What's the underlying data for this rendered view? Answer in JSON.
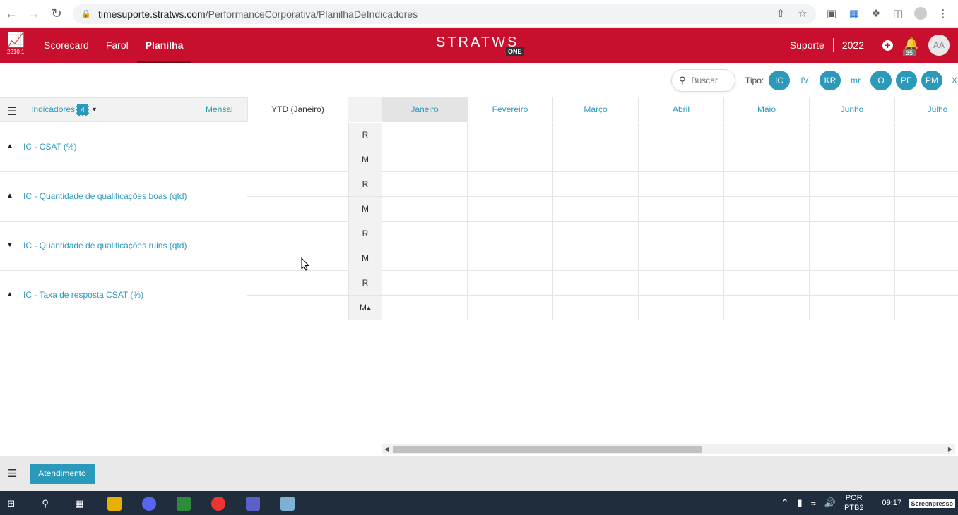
{
  "browser": {
    "url_host": "timesuporte.stratws.com",
    "url_path": "/PerformanceCorporativa/PlanilhaDeIndicadores"
  },
  "app": {
    "version": "2210.1",
    "nav": [
      "Scorecard",
      "Farol",
      "Planilha"
    ],
    "active_nav": "Planilha",
    "brand": "STRATWS",
    "brand_badge": "ONE",
    "context": "Suporte",
    "year": "2022",
    "notif_count": "35",
    "avatar": "AA"
  },
  "filters": {
    "search_placeholder": "Buscar",
    "tipo_label": "Tipo:",
    "chips": [
      {
        "label": "IC",
        "active": true
      },
      {
        "label": "IV",
        "active": false
      },
      {
        "label": "KR",
        "active": true
      },
      {
        "label": "mr",
        "active": false
      },
      {
        "label": "O",
        "active": true
      },
      {
        "label": "PE",
        "active": true
      },
      {
        "label": "PM",
        "active": true
      },
      {
        "label": "XY",
        "active": false
      }
    ]
  },
  "grid": {
    "indicators_label": "Indicadores",
    "indicators_count": "4",
    "period": "Mensal",
    "ytd": "YTD (Janeiro)",
    "months": [
      "Janeiro",
      "Fevereiro",
      "Março",
      "Abril",
      "Maio",
      "Junho",
      "Julho"
    ],
    "current_month": "Janeiro",
    "rows": [
      {
        "name": "IC - CSAT (%)",
        "direction": "up",
        "r": "R",
        "m": "M"
      },
      {
        "name": "IC - Quantidade de qualificações boas (qtd)",
        "direction": "up",
        "r": "R",
        "m": "M"
      },
      {
        "name": "IC - Quantidade de qualificações ruins (qtd)",
        "direction": "down",
        "r": "R",
        "m": "M"
      },
      {
        "name": "IC - Taxa de resposta CSAT (%)",
        "direction": "up",
        "r": "R",
        "m": "M▴"
      }
    ]
  },
  "footer": {
    "tab": "Atendimento"
  },
  "taskbar": {
    "lang1": "POR",
    "lang2": "PTB2",
    "time": "09:17",
    "watermark": "Screenpresso"
  }
}
